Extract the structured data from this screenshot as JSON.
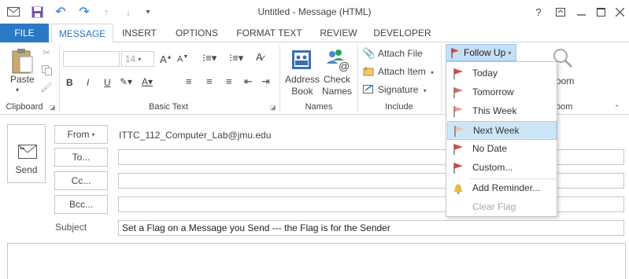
{
  "window": {
    "title": "Untitled - Message (HTML)",
    "help_label": "?"
  },
  "tabs": {
    "file": "FILE",
    "items": [
      "MESSAGE",
      "INSERT",
      "OPTIONS",
      "FORMAT TEXT",
      "REVIEW",
      "DEVELOPER"
    ],
    "active": "MESSAGE"
  },
  "ribbon": {
    "clipboard": {
      "paste": "Paste",
      "label": "Clipboard"
    },
    "basic_text": {
      "font_size": "14",
      "bold": "B",
      "italic": "I",
      "underline": "U",
      "label": "Basic Text"
    },
    "names": {
      "address_book": [
        "Address",
        "Book"
      ],
      "check_names": [
        "Check",
        "Names"
      ],
      "label": "Names"
    },
    "include": {
      "attach_file": "Attach File",
      "attach_item": "Attach Item",
      "signature": "Signature",
      "label": "Include"
    },
    "tags": {
      "follow_up": "Follow Up"
    },
    "zoom": {
      "button": "oom",
      "label": "oom"
    }
  },
  "compose": {
    "send": "Send",
    "from": "From",
    "from_value": "ITTC_112_Computer_Lab@jmu.edu",
    "to": "To...",
    "cc": "Cc...",
    "bcc": "Bcc...",
    "subject_label": "Subject",
    "subject_value": "Set a Flag on a Message you Send --- the Flag is for the Sender",
    "to_value": "",
    "cc_value": "",
    "bcc_value": ""
  },
  "menu": {
    "items": [
      {
        "label": "Today",
        "flag_color": "#d9473a",
        "enabled": true
      },
      {
        "label": "Tomorrow",
        "flag_color": "#e06a5e",
        "enabled": true
      },
      {
        "label": "This Week",
        "flag_color": "#ec9a92",
        "enabled": true
      },
      {
        "label": "Next Week",
        "flag_color": "#f2bcb7",
        "enabled": true,
        "highlighted": true
      },
      {
        "label": "No Date",
        "flag_color": "#d9473a",
        "enabled": true
      },
      {
        "label": "Custom...",
        "flag_color": "#d9473a",
        "enabled": true
      },
      {
        "label": "Add Reminder...",
        "enabled": true
      },
      {
        "label": "Clear Flag",
        "enabled": false
      }
    ]
  },
  "colors": {
    "accent": "#2b78c5",
    "highlight": "#cde6f7",
    "follow_up_bg": "#c5dff7"
  }
}
